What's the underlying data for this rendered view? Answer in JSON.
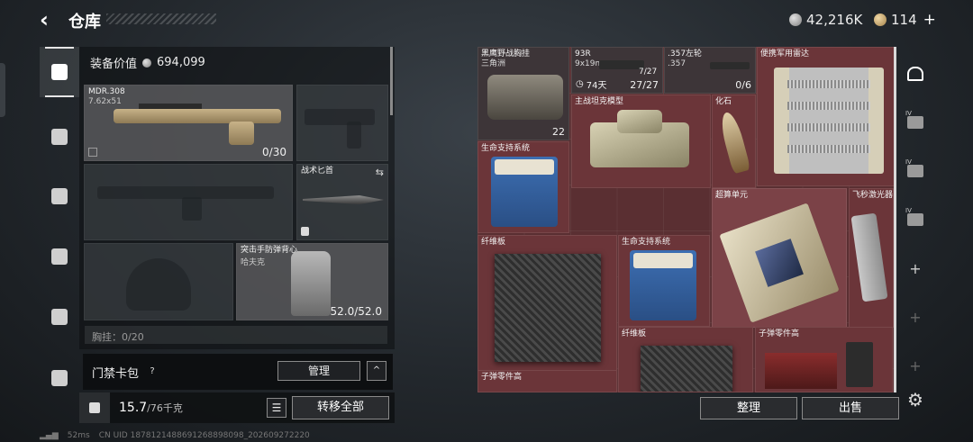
{
  "header": {
    "back_icon": "back-arrow-icon",
    "title": "仓库",
    "silver_amount": "42,216K",
    "gold_amount": "114",
    "plus_label": "+"
  },
  "left_rail": {
    "items": [
      {
        "icon": "pistol-icon",
        "active": true
      },
      {
        "icon": "armor-icon",
        "active": false
      },
      {
        "icon": "helmet-icon",
        "active": false
      },
      {
        "icon": "backpack-icon",
        "active": false
      },
      {
        "icon": "rig-icon",
        "active": false
      },
      {
        "icon": "toolbox-icon",
        "active": false
      }
    ]
  },
  "equipment": {
    "value_label": "装备价值",
    "value": "694,099",
    "primary": {
      "name": "MDR.308",
      "caliber": "7.62x51",
      "count": "0/30"
    },
    "knife": {
      "name": "战术匕首"
    },
    "vest": {
      "name": "突击手防弹背心",
      "sub": "哈夫克",
      "durability": "52.0/52.0"
    },
    "next_slot_label": "胸挂：0/20"
  },
  "card_pack": {
    "label": "门禁卡包",
    "help": "?",
    "manage_label": "管理",
    "collapse_label": "^"
  },
  "capacity": {
    "current": "15.7",
    "max": "/76千克",
    "list_icon": "list-icon",
    "transfer_all_label": "转移全部"
  },
  "status": {
    "ping": "52ms",
    "uid": "CN UID 1878121488691268898098_202609272220"
  },
  "storage": {
    "items": [
      {
        "id": "vest-bag",
        "name": "黑鹰野战胸挂",
        "sub": "三角洲",
        "count": "22"
      },
      {
        "id": "93r",
        "name": "93R",
        "sub": "9x19mm",
        "ammo": "7/27",
        "timer": "74天",
        "count": "27/27"
      },
      {
        "id": "357",
        "name": ".357左轮",
        "sub": ".357",
        "count": "0/6"
      },
      {
        "id": "radar",
        "name": "便携军用雷达"
      },
      {
        "id": "tank",
        "name": "主战坦克模型"
      },
      {
        "id": "fossil",
        "name": "化石"
      },
      {
        "id": "life1",
        "name": "生命支持系统"
      },
      {
        "id": "cpu",
        "name": "超算单元"
      },
      {
        "id": "laser",
        "name": "飞秒激光器"
      },
      {
        "id": "fiber1",
        "name": "纤维板"
      },
      {
        "id": "life2",
        "name": "生命支持系统"
      },
      {
        "id": "fiber2",
        "name": "纤维板"
      },
      {
        "id": "bullet1",
        "name": "子弹零件高"
      },
      {
        "id": "bullet2",
        "name": "子弹零件高"
      }
    ]
  },
  "right_rail": {
    "items": [
      {
        "icon": "warehouse-icon",
        "active": true
      },
      {
        "icon": "storage-add-icon",
        "tag": "IV"
      },
      {
        "icon": "storage-box-icon",
        "tag": "IV"
      },
      {
        "icon": "storage-case-icon",
        "tag": "IV"
      },
      {
        "icon": "add-icon",
        "label": "+"
      },
      {
        "icon": "settings-icon"
      }
    ]
  },
  "actions": {
    "sort_label": "整理",
    "sell_label": "出售"
  }
}
